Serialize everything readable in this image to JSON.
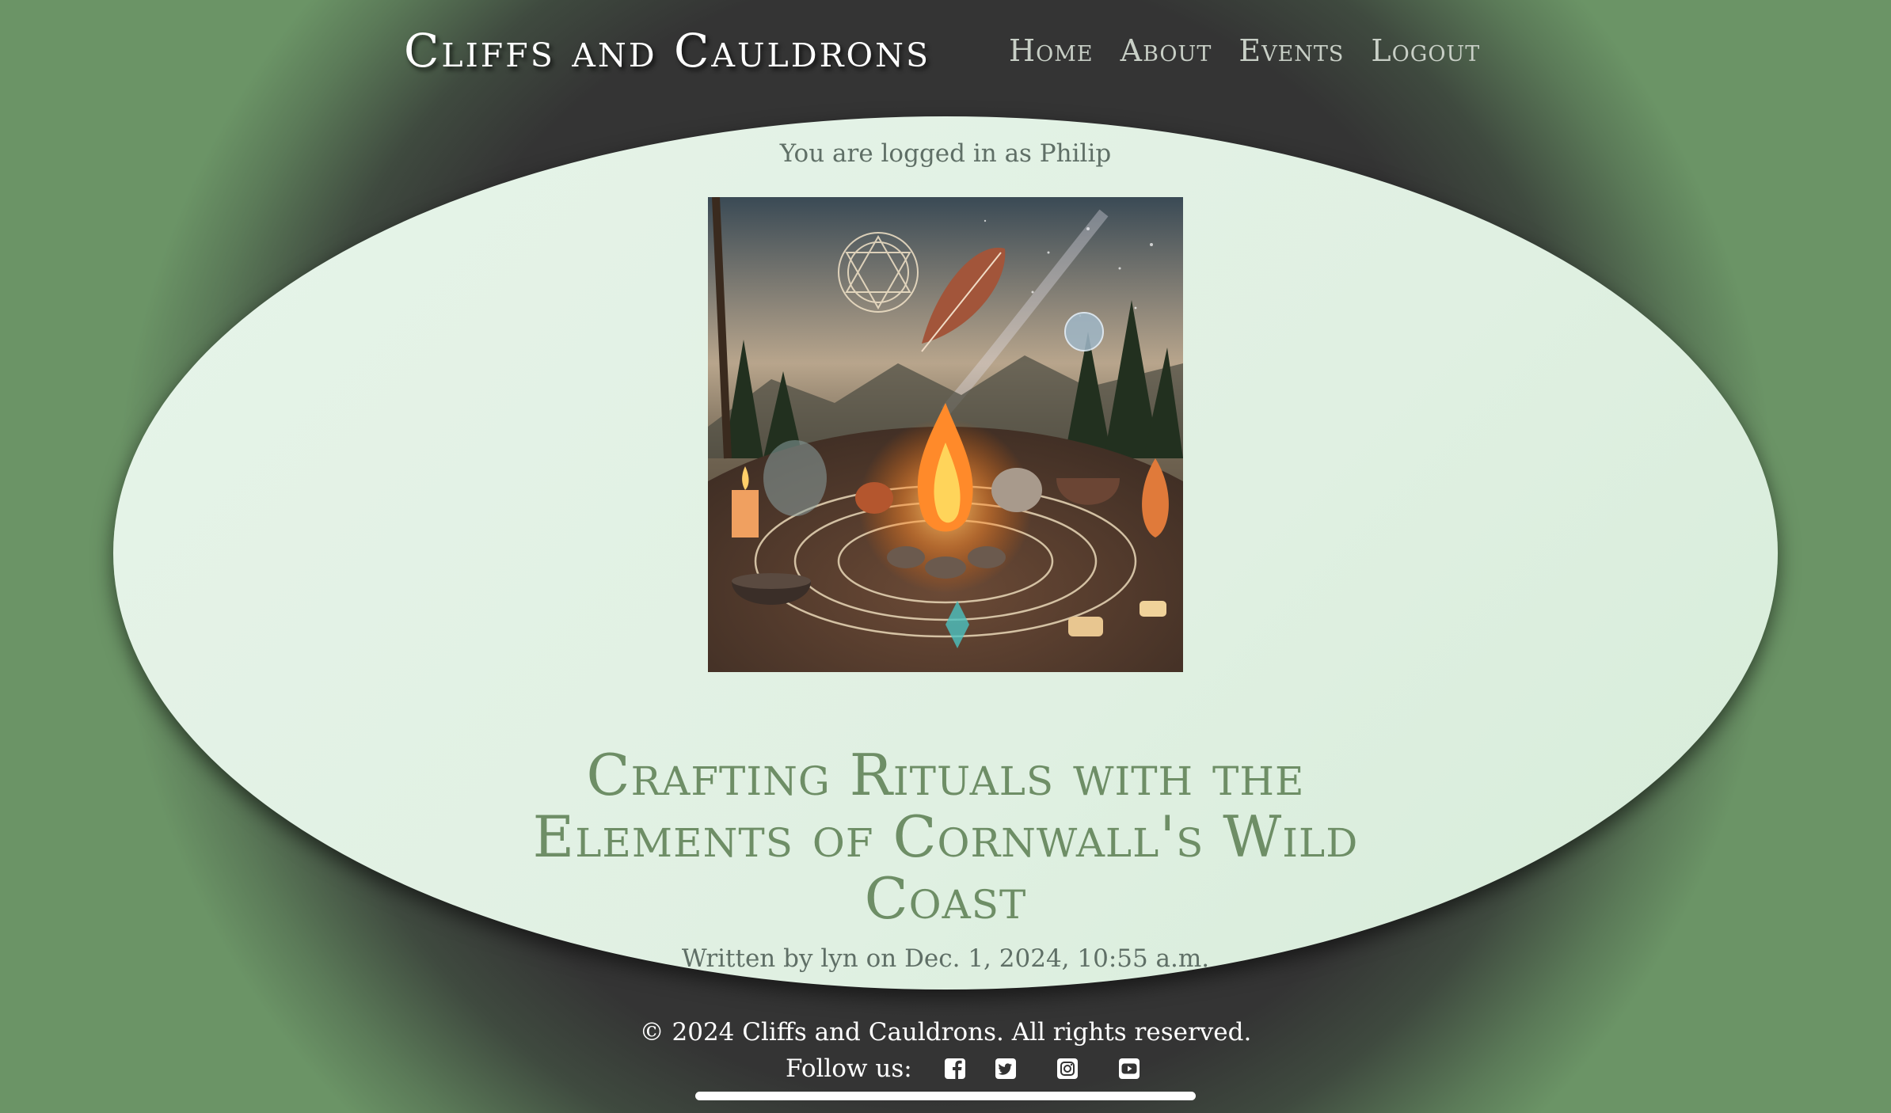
{
  "header": {
    "brand": "Cliffs and Cauldrons",
    "nav": [
      {
        "label": "Home"
      },
      {
        "label": "About"
      },
      {
        "label": "Events"
      },
      {
        "label": "Logout"
      }
    ]
  },
  "main": {
    "login_status": "You are logged in as Philip",
    "hero_image": {
      "icon": "ritual-illustration"
    },
    "post_title": "Crafting Rituals with the Elements of Cornwall's Wild Coast",
    "byline": "Written by lyn on Dec. 1, 2024, 10:55 a.m."
  },
  "footer": {
    "copyright": "© 2024 Cliffs and Cauldrons. All rights reserved.",
    "follow_label": "Follow us:",
    "social": [
      "facebook-icon",
      "twitter-icon",
      "instagram-icon",
      "youtube-icon"
    ]
  },
  "colors": {
    "oval_bg": "#e3f2e6",
    "title_green": "#6e8e66",
    "page_dark": "#333333",
    "edge_green": "#6b9466"
  }
}
